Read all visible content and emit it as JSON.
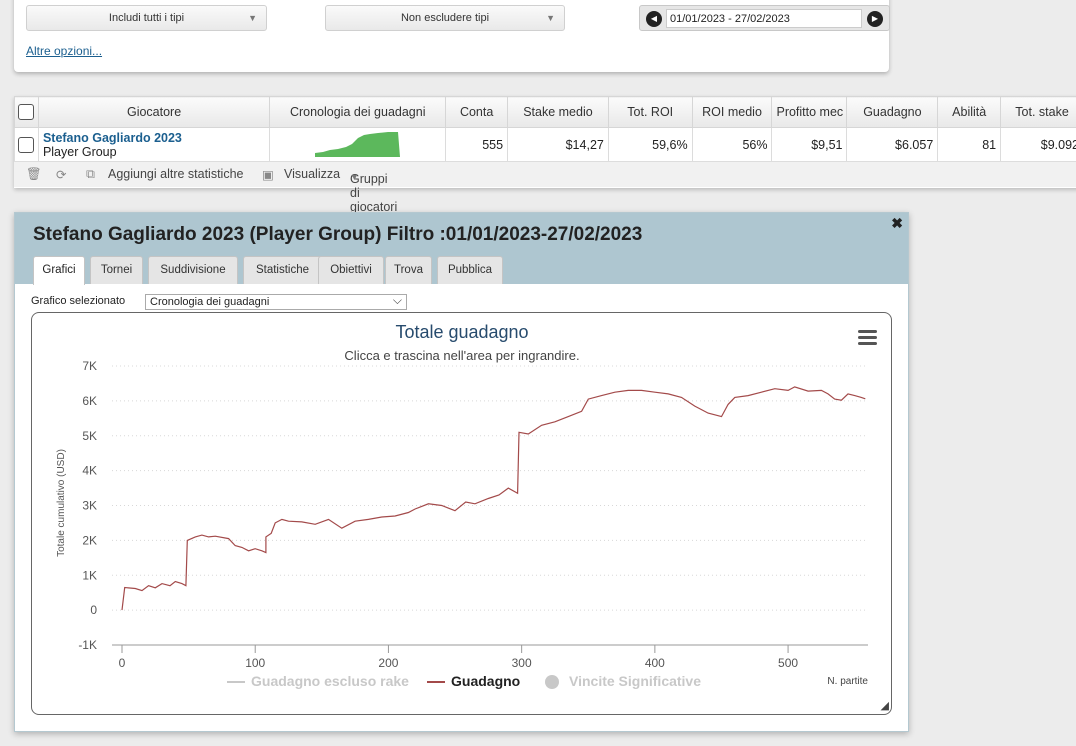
{
  "filters": {
    "include_types": "Includi tutti i tipi",
    "exclude_types": "Non escludere tipi",
    "date_range": "01/01/2023 - 27/02/2023",
    "more_options": "Altre opzioni..."
  },
  "table": {
    "columns": [
      "Giocatore",
      "Cronologia dei guadagni",
      "Conta",
      "Stake medio",
      "Tot. ROI",
      "ROI medio",
      "Profitto mec",
      "Guadagno",
      "Abilità",
      "Tot. stake"
    ],
    "row": {
      "player": "Stefano Gagliardo 2023",
      "group": "Player Group",
      "count": "555",
      "avg_stake": "$14,27",
      "tot_roi": "59,6%",
      "avg_roi": "56%",
      "avg_profit": "$9,51",
      "profit": "$6.057",
      "skill": "81",
      "tot_stake": "$9.092"
    }
  },
  "toolbar": {
    "add_stats": "Aggiungi altre statistiche",
    "view": "Visualizza",
    "player_groups": "Gruppi di giocatori"
  },
  "dialog": {
    "title": "Stefano Gagliardo 2023 (Player Group) Filtro :01/01/2023-27/02/2023",
    "tabs": [
      "Grafici",
      "Tornei",
      "Suddivisione",
      "Statistiche",
      "Obiettivi",
      "Trova",
      "Pubblica"
    ],
    "active_tab": "Grafici",
    "chart_select_label": "Grafico selezionato",
    "chart_select_value": "Cronologia dei guadagni"
  },
  "chart_data": {
    "type": "line",
    "title": "Totale guadagno",
    "subtitle": "Clicca e trascina nell'area per ingrandire.",
    "ylabel": "Totale cumulativo (USD)",
    "xlabel": "N. partite",
    "xlim": [
      0,
      560
    ],
    "ylim": [
      -1000,
      7000
    ],
    "xticks": [
      0,
      100,
      200,
      300,
      400,
      500
    ],
    "yticks": [
      -1000,
      0,
      1000,
      2000,
      3000,
      4000,
      5000,
      6000,
      7000
    ],
    "ytick_labels": [
      "-1K",
      "0",
      "1K",
      "2K",
      "3K",
      "4K",
      "5K",
      "6K",
      "7K"
    ],
    "grid": true,
    "colors": {
      "series": "#a34a4a",
      "inactive": "#c8c8c8",
      "legend_active": "#222222"
    },
    "legend": [
      {
        "name": "Guadagno escluso rake",
        "visible": false,
        "marker": "line"
      },
      {
        "name": "Guadagno",
        "visible": true,
        "marker": "line"
      },
      {
        "name": "Vincite Significative",
        "visible": false,
        "marker": "circle"
      }
    ],
    "series": [
      {
        "name": "Guadagno",
        "points": [
          [
            0,
            0
          ],
          [
            2,
            650
          ],
          [
            10,
            620
          ],
          [
            15,
            560
          ],
          [
            20,
            700
          ],
          [
            25,
            640
          ],
          [
            30,
            760
          ],
          [
            36,
            700
          ],
          [
            40,
            820
          ],
          [
            45,
            760
          ],
          [
            48,
            700
          ],
          [
            49,
            2000
          ],
          [
            55,
            2100
          ],
          [
            60,
            2150
          ],
          [
            65,
            2100
          ],
          [
            70,
            2120
          ],
          [
            80,
            2050
          ],
          [
            85,
            1850
          ],
          [
            90,
            1800
          ],
          [
            95,
            1700
          ],
          [
            100,
            1760
          ],
          [
            105,
            1700
          ],
          [
            108,
            1650
          ],
          [
            108,
            2100
          ],
          [
            112,
            2200
          ],
          [
            115,
            2500
          ],
          [
            120,
            2600
          ],
          [
            125,
            2550
          ],
          [
            135,
            2530
          ],
          [
            145,
            2460
          ],
          [
            155,
            2600
          ],
          [
            165,
            2350
          ],
          [
            175,
            2550
          ],
          [
            185,
            2600
          ],
          [
            195,
            2670
          ],
          [
            205,
            2700
          ],
          [
            215,
            2800
          ],
          [
            220,
            2900
          ],
          [
            230,
            3050
          ],
          [
            240,
            3000
          ],
          [
            250,
            2850
          ],
          [
            258,
            3100
          ],
          [
            265,
            3050
          ],
          [
            275,
            3200
          ],
          [
            283,
            3300
          ],
          [
            290,
            3500
          ],
          [
            297,
            3350
          ],
          [
            298,
            5100
          ],
          [
            305,
            5050
          ],
          [
            315,
            5300
          ],
          [
            325,
            5400
          ],
          [
            335,
            5550
          ],
          [
            345,
            5700
          ],
          [
            350,
            6050
          ],
          [
            360,
            6150
          ],
          [
            370,
            6250
          ],
          [
            380,
            6300
          ],
          [
            390,
            6300
          ],
          [
            400,
            6250
          ],
          [
            410,
            6200
          ],
          [
            420,
            6100
          ],
          [
            430,
            5850
          ],
          [
            435,
            5750
          ],
          [
            440,
            5650
          ],
          [
            445,
            5600
          ],
          [
            450,
            5550
          ],
          [
            455,
            5900
          ],
          [
            460,
            6100
          ],
          [
            470,
            6150
          ],
          [
            480,
            6250
          ],
          [
            490,
            6350
          ],
          [
            500,
            6300
          ],
          [
            505,
            6400
          ],
          [
            515,
            6280
          ],
          [
            525,
            6300
          ],
          [
            530,
            6200
          ],
          [
            535,
            6050
          ],
          [
            540,
            6020
          ],
          [
            545,
            6200
          ],
          [
            550,
            6150
          ],
          [
            555,
            6100
          ],
          [
            558,
            6060
          ]
        ]
      }
    ]
  }
}
